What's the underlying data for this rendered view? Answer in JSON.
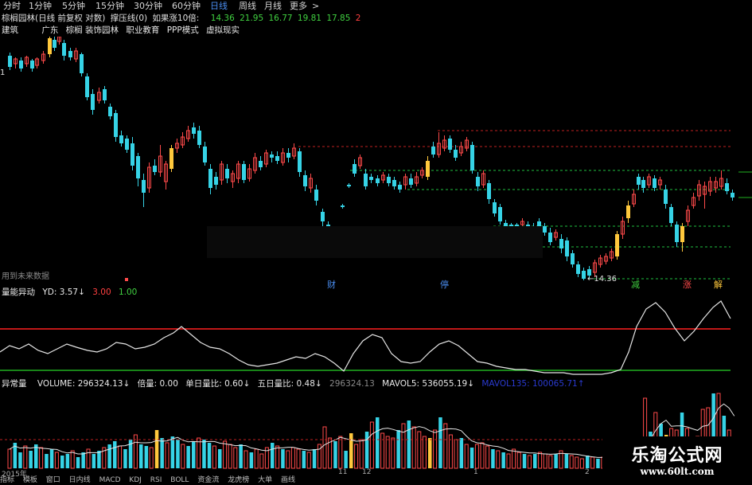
{
  "toolbar": {
    "items": [
      "分时",
      "1分钟",
      "5分钟",
      "15分钟",
      "30分钟",
      "60分钟",
      "日线",
      "周线",
      "月线",
      "更多",
      ">"
    ],
    "active_index": 6
  },
  "title_row": {
    "stock_name": "棕榈园林(日线 前复权 对数)",
    "indicator": "撑压线(0)",
    "hint": "如果涨10倍:",
    "values": [
      "14.36",
      "21.95",
      "16.77",
      "19.81",
      "17.85",
      "2"
    ]
  },
  "tags": [
    "建筑",
    "广东",
    "棕榈",
    "装饰园林",
    "职业教育",
    "PPP模式",
    "虚拟现实"
  ],
  "main_chart": {
    "future_data_note": "用到未来数据",
    "low_price_label": "←14.36",
    "event_labels": [
      "财",
      "停",
      "减",
      "涨",
      "解"
    ],
    "last_price": "1"
  },
  "indicator_panel": {
    "name": "量能异动",
    "params": [
      {
        "label": "YD: 3.57↓",
        "color": "#e8e8e8"
      },
      {
        "label": "3.00",
        "color": "#ff4040"
      },
      {
        "label": "1.00",
        "color": "#40d040"
      }
    ]
  },
  "volume_panel": {
    "name": "异常量",
    "params": [
      {
        "label": "VOLUME: 296324.13↓",
        "color": "#e8e8e8"
      },
      {
        "label": "倍量: 0.00",
        "color": "#e8e8e8"
      },
      {
        "label": "单日量比: 0.60↓",
        "color": "#e8e8e8"
      },
      {
        "label": "五日量比: 0.48↓",
        "color": "#e8e8e8"
      },
      {
        "label": "296324.13",
        "color": "#888888"
      },
      {
        "label": "MAVOL5: 536055.19↓",
        "color": "#e8e8e8"
      },
      {
        "label": "MAVOL135: 100065.71↑",
        "color": "#2a3ad0"
      }
    ],
    "date_labels": [
      "2015年",
      "11",
      "12",
      "1",
      "2"
    ]
  },
  "bottom_tabs": [
    "指标",
    "模板",
    "窗口",
    "日内线",
    "MACD",
    "KDJ",
    "RSI",
    "BOLL",
    "资金流",
    "龙虎榜",
    "大单",
    "画线"
  ],
  "watermark": {
    "brand": "乐淘公式网",
    "url": "www.60lt.com"
  },
  "colors": {
    "up": "#ff4a4a",
    "down": "#36d3e6",
    "highlight": "#ffc83c",
    "limit_line": "#ff2020",
    "base_line": "#20b020",
    "resist_dash": "#c02020",
    "support_dash": "#20c040",
    "accent_blue": "#4a8df0"
  }
}
